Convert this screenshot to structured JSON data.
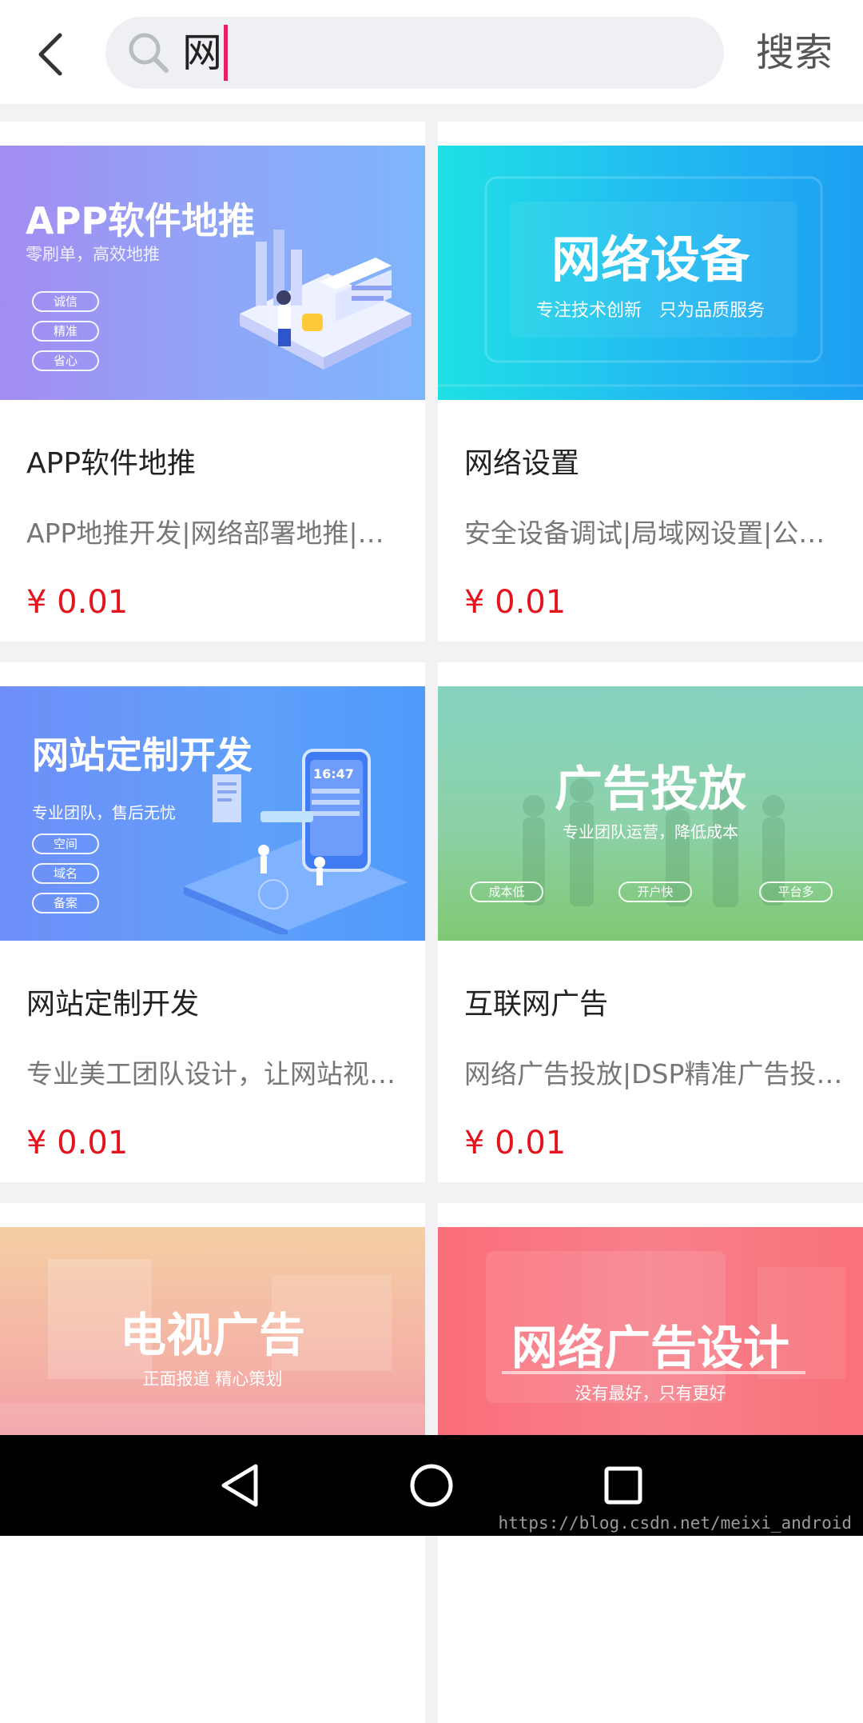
{
  "search": {
    "query": "网",
    "submit_label": "搜索"
  },
  "products": [
    {
      "title": "APP软件地推",
      "desc": "APP地推开发|网络部署地推|…",
      "price": "¥ 0.01",
      "banner": {
        "title": "APP软件地推",
        "subtitle": "零刷单，高效地推",
        "tags": [
          "诚信",
          "精准",
          "省心"
        ]
      }
    },
    {
      "title": "网络设置",
      "desc": "安全设备调试|局域网设置|公…",
      "price": "¥ 0.01",
      "banner": {
        "title": "网络设备",
        "subtitle": "专注技术创新　只为品质服务"
      }
    },
    {
      "title": "网站定制开发",
      "desc": "专业美工团队设计，让网站视…",
      "price": "¥ 0.01",
      "banner": {
        "title": "网站定制开发",
        "subtitle": "专业团队，售后无忧",
        "tags": [
          "空间",
          "域名",
          "备案"
        ],
        "phone_time": "16:47"
      }
    },
    {
      "title": "互联网广告",
      "desc": "网络广告投放|DSP精准广告投…",
      "price": "¥ 0.01",
      "banner": {
        "title": "广告投放",
        "subtitle": "专业团队运营，降低成本",
        "tags": [
          "成本低",
          "开户快",
          "平台多"
        ]
      }
    },
    {
      "banner": {
        "title": "电视广告",
        "subtitle": "正面报道  精心策划"
      }
    },
    {
      "banner": {
        "title": "网络广告设计",
        "subtitle": "没有最好，只有更好"
      }
    }
  ],
  "watermark": "https://blog.csdn.net/meixi_android",
  "colors": {
    "price": "#e4141e",
    "cursor": "#e4206a",
    "search_bg": "#eef0f4"
  }
}
